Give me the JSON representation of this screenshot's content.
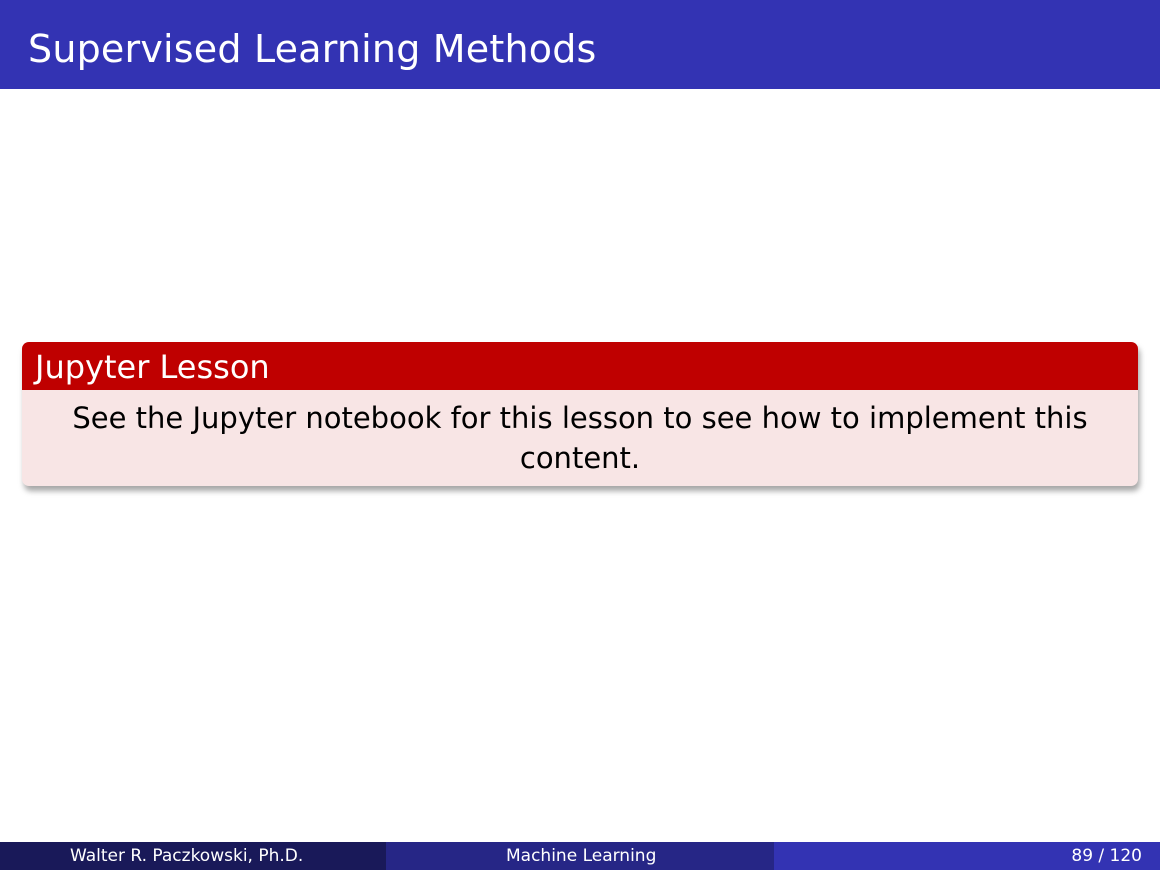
{
  "slide": {
    "title": "Supervised Learning Methods"
  },
  "block": {
    "title": "Jupyter Lesson",
    "body": "See the Jupyter notebook for this lesson to see how to implement this content."
  },
  "footer": {
    "author": "Walter R. Paczkowski, Ph.D.",
    "course": "Machine Learning",
    "page": "89 / 120"
  },
  "colors": {
    "title_bar": "#3333b3",
    "block_header": "#bf0000",
    "block_body": "#f8e5e5",
    "footer_left": "#191959",
    "footer_middle": "#262686",
    "footer_right": "#3333b3"
  }
}
